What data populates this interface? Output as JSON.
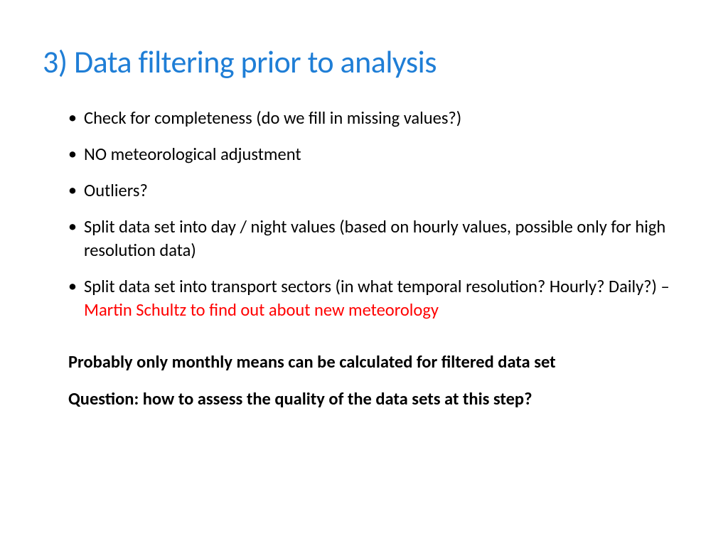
{
  "slide": {
    "title": "3) Data filtering prior to analysis",
    "bullets": [
      {
        "text": "Check for completeness (do we fill in missing values?)"
      },
      {
        "text": "NO meteorological adjustment"
      },
      {
        "text": "Outliers?"
      },
      {
        "text": "Split data set into day / night values (based on hourly values, possible only for high resolution data)"
      },
      {
        "text_prefix": "Split data set into transport sectors (in what temporal resolution? Hourly? Daily?) – ",
        "text_red": "Martin Schultz to find out about new meteorology"
      }
    ],
    "note1": "Probably only monthly means can be calculated for filtered data set",
    "note2": "Question: how to assess the quality of the data sets at this step?"
  }
}
